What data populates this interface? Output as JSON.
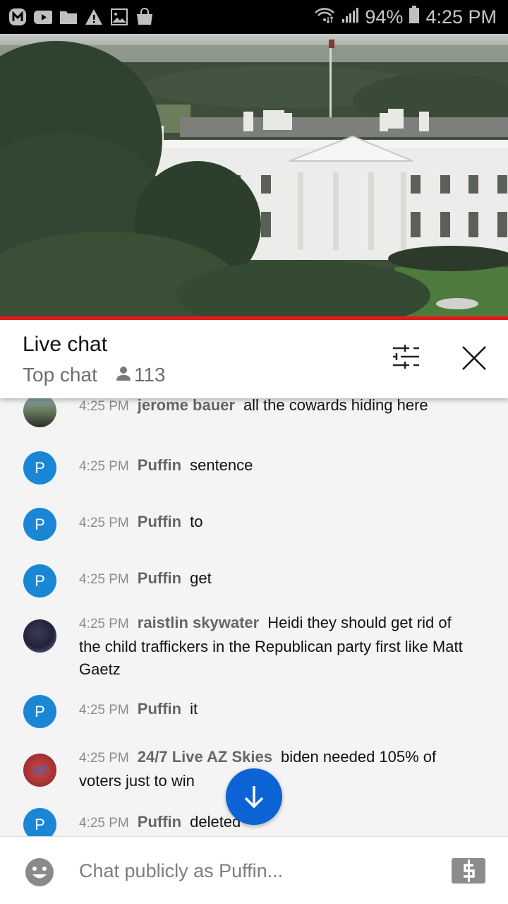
{
  "status_bar": {
    "left_icons": [
      "m-app-icon",
      "youtube-icon",
      "folder-icon",
      "warning-icon",
      "gallery-icon",
      "shopping-bag-icon"
    ],
    "battery": "94%",
    "time": "4:25 PM"
  },
  "video": {
    "description": "Live stream of the White House with the Jefferson Memorial in background",
    "progress_color": "#e51a1a"
  },
  "chat_header": {
    "title": "Live chat",
    "mode": "Top chat",
    "viewer_count": "113"
  },
  "messages": [
    {
      "time": "4:25 PM",
      "author": "jerome bauer",
      "text": "all the cowards hiding here",
      "avatar": "photo"
    },
    {
      "time": "4:25 PM",
      "author": "Puffin",
      "text": "sentence",
      "avatar": "P"
    },
    {
      "time": "4:25 PM",
      "author": "Puffin",
      "text": "to",
      "avatar": "P"
    },
    {
      "time": "4:25 PM",
      "author": "Puffin",
      "text": "get",
      "avatar": "P"
    },
    {
      "time": "4:25 PM",
      "author": "raistlin skywater",
      "text": "Heidi they should get rid of the child traffickers in the Republican party first like Matt Gaetz",
      "avatar": "photo"
    },
    {
      "time": "4:25 PM",
      "author": "Puffin",
      "text": "it",
      "avatar": "P"
    },
    {
      "time": "4:25 PM",
      "author": "24/7 Live AZ Skies",
      "text": "biden needed 105% of voters just to win",
      "avatar": "AZ"
    },
    {
      "time": "4:25 PM",
      "author": "Puffin",
      "text": "deleted",
      "avatar": "P"
    }
  ],
  "input": {
    "placeholder": "Chat publicly as Puffin..."
  },
  "colors": {
    "accent_blue": "#0b63d6",
    "avatar_blue": "#1a87d6",
    "progress_red": "#e51a1a"
  }
}
